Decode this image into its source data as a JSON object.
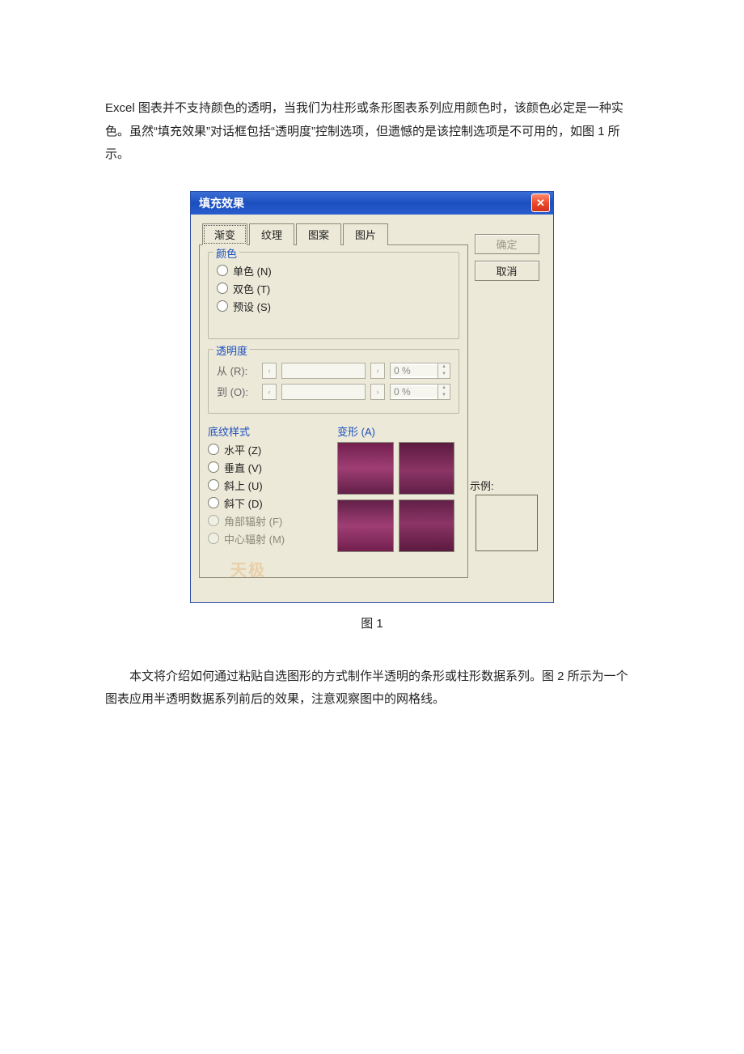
{
  "document": {
    "paragraph1": "Excel 图表并不支持颜色的透明，当我们为柱形或条形图表系列应用颜色时，该颜色必定是一种实色。虽然“填充效果”对话框包括“透明度”控制选项，但遗憾的是该控制选项是不可用的，如图 1 所示。",
    "caption1": "图 1",
    "paragraph2": "本文将介绍如何通过粘贴自选图形的方式制作半透明的条形或柱形数据系列。图 2 所示为一个图表应用半透明数据系列前后的效果，注意观察图中的网格线。"
  },
  "dialog": {
    "title": "填充效果",
    "close": "✕",
    "tabs": [
      "渐变",
      "纹理",
      "图案",
      "图片"
    ],
    "buttons": {
      "ok": "确定",
      "cancel": "取消"
    },
    "groups": {
      "color": {
        "title": "颜色",
        "options": [
          "单色 (N)",
          "双色 (T)",
          "预设 (S)"
        ]
      },
      "transparency": {
        "title": "透明度",
        "from_label": "从 (R):",
        "to_label": "到 (O):",
        "value": "0 %"
      },
      "style": {
        "title": "底纹样式",
        "options": [
          "水平 (Z)",
          "垂直 (V)",
          "斜上 (U)",
          "斜下 (D)",
          "角部辐射 (F)",
          "中心辐射 (M)"
        ]
      },
      "variant": {
        "title": "变形 (A)"
      }
    },
    "example_label": "示例:",
    "watermark": "天极"
  }
}
